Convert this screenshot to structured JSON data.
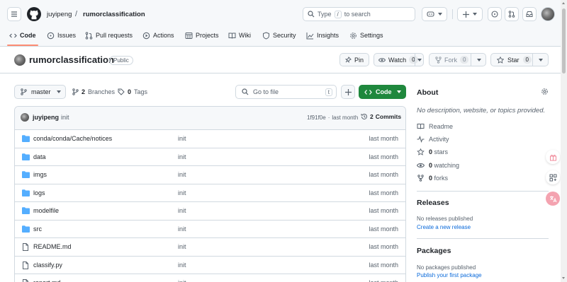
{
  "header": {
    "owner": "juyipeng",
    "separator": "/",
    "repo": "rumorclassification",
    "search_prefix": "Type",
    "search_key": "/",
    "search_suffix": "to search"
  },
  "tabs": [
    {
      "label": "Code",
      "icon": "code-icon"
    },
    {
      "label": "Issues",
      "icon": "issue-icon"
    },
    {
      "label": "Pull requests",
      "icon": "pull-request-icon"
    },
    {
      "label": "Actions",
      "icon": "play-icon"
    },
    {
      "label": "Projects",
      "icon": "table-icon"
    },
    {
      "label": "Wiki",
      "icon": "book-icon"
    },
    {
      "label": "Security",
      "icon": "shield-icon"
    },
    {
      "label": "Insights",
      "icon": "graph-icon"
    },
    {
      "label": "Settings",
      "icon": "gear-icon"
    }
  ],
  "repo_header": {
    "name": "rumorclassification",
    "visibility": "Public",
    "pin_label": "Pin",
    "watch_label": "Watch",
    "watch_count": "0",
    "fork_label": "Fork",
    "fork_count": "0",
    "star_label": "Star",
    "star_count": "0"
  },
  "toolbar": {
    "branch": "master",
    "branches_count": "2",
    "branches_label": "Branches",
    "tags_count": "0",
    "tags_label": "Tags",
    "goto_placeholder": "Go to file",
    "goto_key": "t",
    "code_label": "Code"
  },
  "commit": {
    "author": "juyipeng",
    "message": "init",
    "hash": "1f91f0e",
    "separator": "·",
    "time": "last month",
    "commits_count": "2",
    "commits_label": "Commits"
  },
  "files": [
    {
      "name": "conda/conda/Cache/notices",
      "type": "folder",
      "message": "init",
      "date": "last month"
    },
    {
      "name": "data",
      "type": "folder",
      "message": "init",
      "date": "last month"
    },
    {
      "name": "imgs",
      "type": "folder",
      "message": "init",
      "date": "last month"
    },
    {
      "name": "logs",
      "type": "folder",
      "message": "init",
      "date": "last month"
    },
    {
      "name": "modelfile",
      "type": "folder",
      "message": "init",
      "date": "last month"
    },
    {
      "name": "src",
      "type": "folder",
      "message": "init",
      "date": "last month"
    },
    {
      "name": "README.md",
      "type": "file",
      "message": "init",
      "date": "last month"
    },
    {
      "name": "classify.py",
      "type": "file",
      "message": "init",
      "date": "last month"
    },
    {
      "name": "report.md",
      "type": "file",
      "message": "init",
      "date": "last month"
    }
  ],
  "about": {
    "title": "About",
    "description": "No description, website, or topics provided.",
    "readme": "Readme",
    "activity": "Activity",
    "stars_count": "0",
    "stars_label": "stars",
    "watching_count": "0",
    "watching_label": "watching",
    "forks_count": "0",
    "forks_label": "forks"
  },
  "releases": {
    "title": "Releases",
    "none": "No releases published",
    "create": "Create a new release"
  },
  "packages": {
    "title": "Packages",
    "none": "No packages published",
    "publish": "Publish your first package"
  },
  "colors": {
    "accent_green": "#1f883d",
    "tab_underline": "#fd8c73",
    "link": "#0969da",
    "folder": "#54aeff"
  }
}
